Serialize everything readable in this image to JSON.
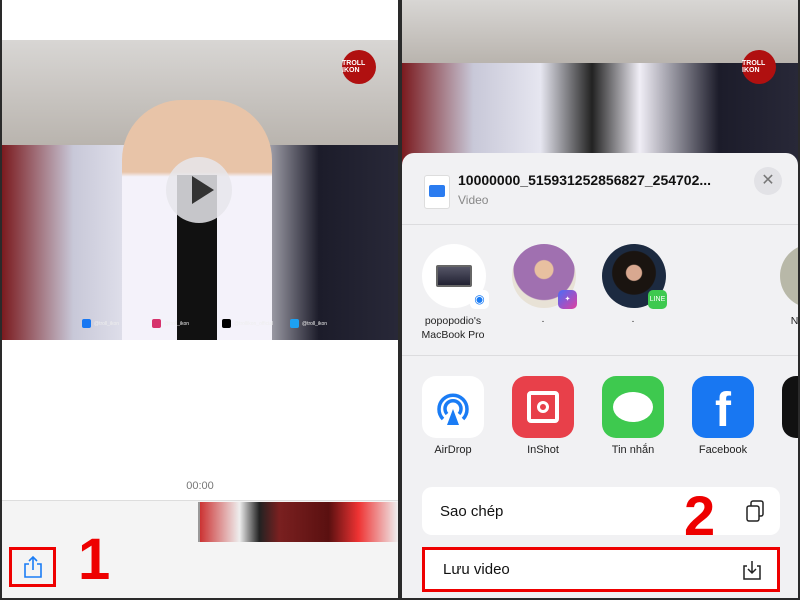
{
  "left_panel": {
    "video": {
      "logo_text": "TROLL IKON",
      "social_handles": [
        "@troll_ikon",
        "@troll_ikon",
        "@trollikon_official",
        "@troll_ikon"
      ]
    },
    "timestamp": "00:00",
    "share_icon": "share-icon",
    "step_number": "1"
  },
  "share_sheet": {
    "file_name": "10000000_515931252856827_254702...",
    "file_type": "Video",
    "people": [
      {
        "label": "popopodio's MacBook Pro",
        "badge": "airdrop"
      },
      {
        "label": "·",
        "badge": "messenger"
      },
      {
        "label": "·",
        "badge": "line"
      },
      {
        "label": "Ngh",
        "badge": ""
      }
    ],
    "apps": [
      {
        "label": "AirDrop",
        "color": "#ffffff"
      },
      {
        "label": "InShot",
        "color": "#e8404a"
      },
      {
        "label": "Tin nhắn",
        "color": "#3ec94f"
      },
      {
        "label": "Facebook",
        "color": "#1877f2"
      }
    ],
    "actions": [
      {
        "label": "Sao chép",
        "icon": "copy-icon"
      },
      {
        "label": "Lưu video",
        "icon": "save-download-icon"
      }
    ],
    "step_number": "2",
    "highlight_color": "#e00000"
  }
}
